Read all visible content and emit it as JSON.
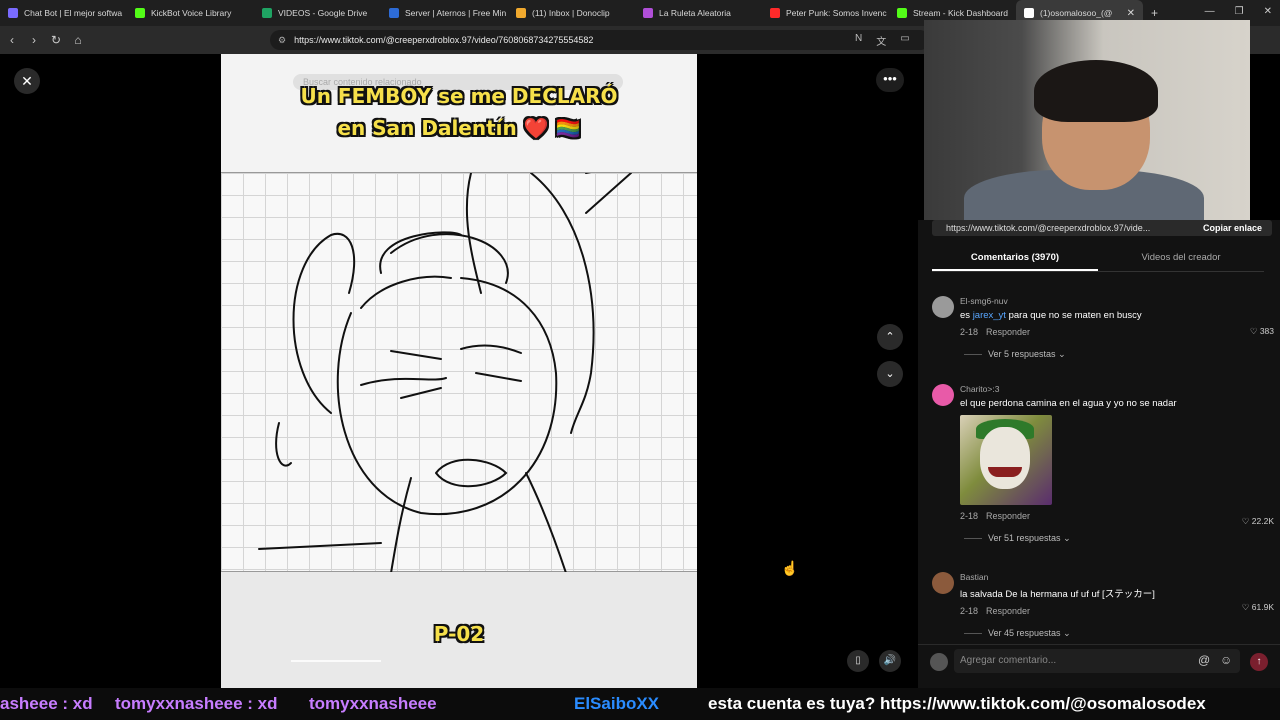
{
  "browser": {
    "tabs": [
      {
        "label": "Chat Bot | El mejor softwa",
        "color": "#7a6bff"
      },
      {
        "label": "KickBot Voice Library",
        "color": "#53fc18"
      },
      {
        "label": "VIDEOS - Google Drive",
        "color": "#1fa463"
      },
      {
        "label": "Server | Aternos | Free Min",
        "color": "#2d6bd6"
      },
      {
        "label": "(11) Inbox | Donoclip",
        "color": "#f0a92e"
      },
      {
        "label": "La Ruleta Aleatoria",
        "color": "#b04fd8"
      },
      {
        "label": "Peter Punk: Somos Invenc",
        "color": "#ff2a2a"
      },
      {
        "label": "Stream - Kick Dashboard",
        "color": "#53fc18"
      },
      {
        "label": "(1)osomalosoo_(@",
        "color": "#ffffff",
        "active": true
      }
    ],
    "url": "https://www.tiktok.com/@creeperxdroblox.97/video/7608068734275554582"
  },
  "video": {
    "search_placeholder": "Buscar contenido relacionado",
    "caption_line1": "Un FEMBOY se me DECLARÓ",
    "caption_line2": "en San Dalentín ❤️ 🏳️‍🌈",
    "page_label": "P-02",
    "progress": 0.19
  },
  "panel": {
    "link_text": "https://www.tiktok.com/@creeperxdroblox.97/vide...",
    "copy_label": "Copiar enlace",
    "tabs": [
      "Comentarios (3970)",
      "Videos del creador"
    ],
    "reply_label": "Responder",
    "comments": [
      {
        "user": "El-smg6-nuv",
        "mention": "jarex_yt",
        "text": " para que no se maten en buscy",
        "date": "2-18",
        "likes": "383",
        "replies": "Ver 5 respuestas",
        "avatar_color": "#9a9a9a"
      },
      {
        "user": "Charito>:3",
        "text": "el que perdona camina en el agua y yo no se nadar",
        "date": "2-18",
        "likes": "22.2K",
        "replies": "Ver 51 respuestas",
        "avatar_color": "#e85aa8"
      },
      {
        "user": "Bastian",
        "text": "la salvada De la hermana uf uf uf [ステッカー]",
        "date": "2-18",
        "likes": "61.9K",
        "replies": "Ver 45 respuestas",
        "avatar_color": "#8b5a3c"
      }
    ],
    "input_placeholder": "Agregar comentario..."
  },
  "ticker": {
    "seg1": "asheee : xd",
    "seg2": "tomyxxnasheee : xd",
    "seg3": "tomyxxnasheee",
    "seg4": "ElSaiboXX",
    "seg5": "esta cuenta es tuya? https://www.tiktok.com/@osomalosodex"
  }
}
